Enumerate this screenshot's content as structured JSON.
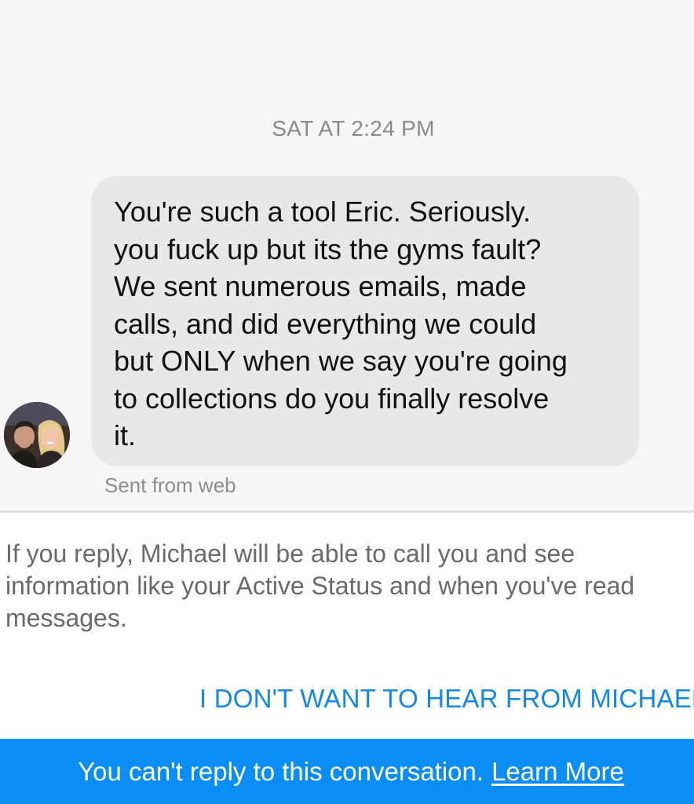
{
  "thread": {
    "timestamp": "SAT AT 2:24 PM",
    "message": {
      "lines": [
        "You're such a tool Eric. Seriously.",
        "you fuck up but its the gyms fault?",
        "We sent numerous emails, made",
        "calls, and did everything we could",
        "but ONLY when we say you're going",
        "to collections do you finally resolve",
        "it."
      ],
      "meta": "Sent from web"
    },
    "avatar_icon": "profile-photo"
  },
  "notice": {
    "lines": [
      "If you reply, Michael will be able to call you and see",
      "information like your Active Status and when you've read",
      "messages."
    ],
    "block_label": "I DON'T WANT TO HEAR FROM MICHAEL"
  },
  "banner": {
    "text": "You can't reply to this conversation.",
    "link": "Learn More"
  },
  "colors": {
    "accent": "#0a8df4",
    "link": "#1289e8",
    "bubble": "#e8e8e8",
    "background": "#f6f6f6"
  }
}
